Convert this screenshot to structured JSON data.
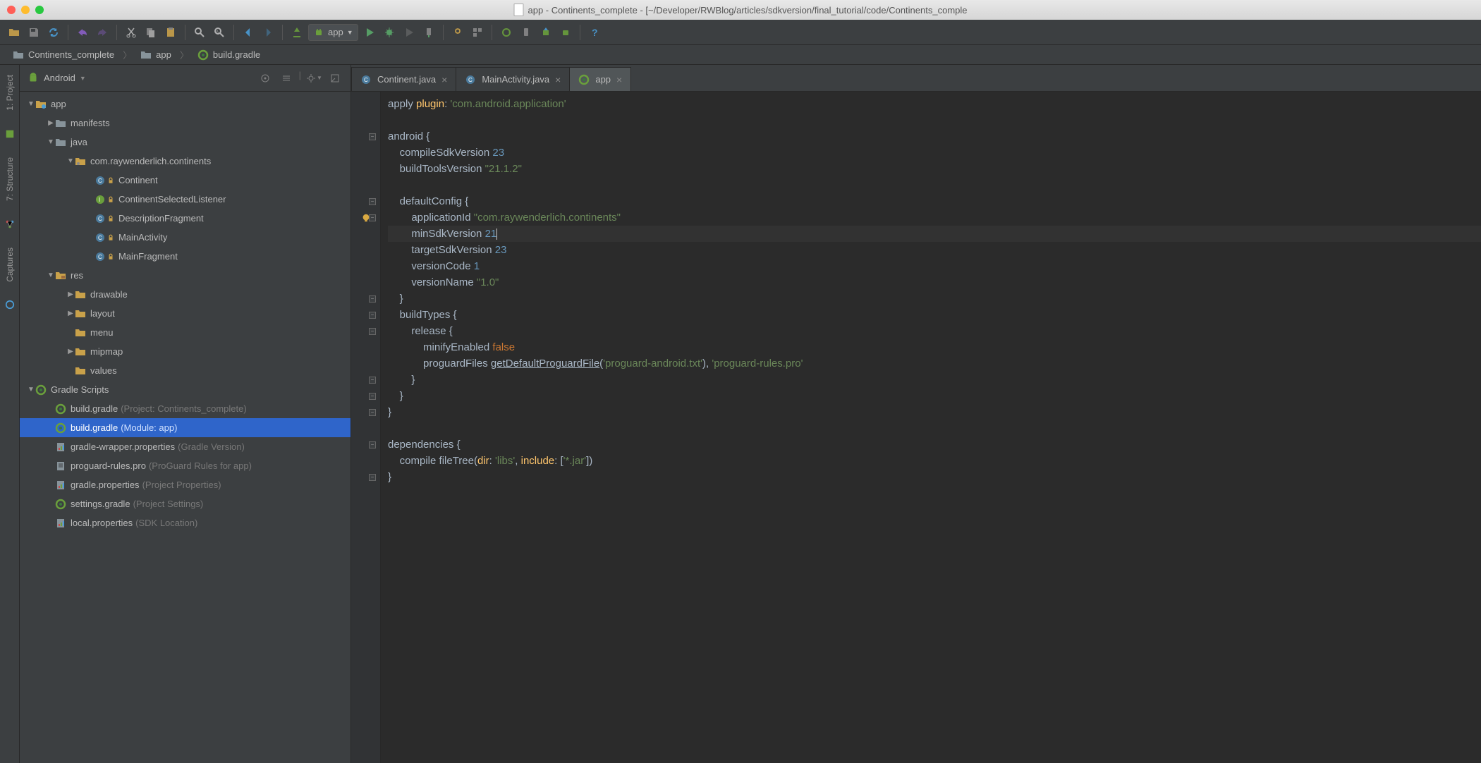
{
  "window": {
    "title": "app - Continents_complete - [~/Developer/RWBlog/articles/sdkversion/final_tutorial/code/Continents_comple"
  },
  "run_config": {
    "label": "app"
  },
  "breadcrumb": [
    {
      "icon": "folder",
      "label": "Continents_complete"
    },
    {
      "icon": "folder",
      "label": "app"
    },
    {
      "icon": "gradle",
      "label": "build.gradle"
    }
  ],
  "left_gutter": [
    {
      "icon": "project",
      "label": "1: Project"
    },
    {
      "icon": "structure",
      "label": "7: Structure"
    },
    {
      "icon": "captures",
      "label": "Captures"
    }
  ],
  "panel": {
    "view": "Android"
  },
  "tree": [
    {
      "d": 0,
      "exp": "open",
      "icon": "module",
      "label": "app"
    },
    {
      "d": 1,
      "exp": "closed",
      "icon": "folder",
      "label": "manifests"
    },
    {
      "d": 1,
      "exp": "open",
      "icon": "folder",
      "label": "java"
    },
    {
      "d": 2,
      "exp": "open",
      "icon": "package",
      "label": "com.raywenderlich.continents"
    },
    {
      "d": 3,
      "icon": "class",
      "label": "Continent"
    },
    {
      "d": 3,
      "icon": "interface",
      "label": "ContinentSelectedListener"
    },
    {
      "d": 3,
      "icon": "class",
      "label": "DescriptionFragment"
    },
    {
      "d": 3,
      "icon": "class",
      "label": "MainActivity"
    },
    {
      "d": 3,
      "icon": "class",
      "label": "MainFragment"
    },
    {
      "d": 1,
      "exp": "open",
      "icon": "res",
      "label": "res"
    },
    {
      "d": 2,
      "exp": "closed",
      "icon": "resfolder",
      "label": "drawable"
    },
    {
      "d": 2,
      "exp": "closed",
      "icon": "resfolder",
      "label": "layout"
    },
    {
      "d": 2,
      "icon": "resfolder",
      "label": "menu"
    },
    {
      "d": 2,
      "exp": "closed",
      "icon": "resfolder",
      "label": "mipmap"
    },
    {
      "d": 2,
      "icon": "resfolder",
      "label": "values"
    },
    {
      "d": 0,
      "exp": "open",
      "icon": "gradle",
      "label": "Gradle Scripts"
    },
    {
      "d": 1,
      "icon": "gradle",
      "label": "build.gradle",
      "hint": "(Project: Continents_complete)"
    },
    {
      "d": 1,
      "icon": "gradle",
      "label": "build.gradle",
      "hint": "(Module: app)",
      "selected": true
    },
    {
      "d": 1,
      "icon": "props",
      "label": "gradle-wrapper.properties",
      "hint": "(Gradle Version)"
    },
    {
      "d": 1,
      "icon": "file",
      "label": "proguard-rules.pro",
      "hint": "(ProGuard Rules for app)"
    },
    {
      "d": 1,
      "icon": "props",
      "label": "gradle.properties",
      "hint": "(Project Properties)"
    },
    {
      "d": 1,
      "icon": "gradle",
      "label": "settings.gradle",
      "hint": "(Project Settings)"
    },
    {
      "d": 1,
      "icon": "props",
      "label": "local.properties",
      "hint": "(SDK Location)"
    }
  ],
  "tabs": [
    {
      "icon": "class",
      "label": "Continent.java",
      "active": false
    },
    {
      "icon": "class",
      "label": "MainActivity.java",
      "active": false
    },
    {
      "icon": "gradle",
      "label": "app",
      "active": true
    }
  ],
  "code": {
    "lines": [
      [
        {
          "t": "apply ",
          "c": "id"
        },
        {
          "t": "plugin",
          "c": "fn"
        },
        {
          "t": ": ",
          "c": "id"
        },
        {
          "t": "'com.android.application'",
          "c": "str"
        }
      ],
      [],
      [
        {
          "t": "android {",
          "c": "id"
        }
      ],
      [
        {
          "t": "    compileSdkVersion ",
          "c": "id"
        },
        {
          "t": "23",
          "c": "num"
        }
      ],
      [
        {
          "t": "    buildToolsVersion ",
          "c": "id"
        },
        {
          "t": "\"21.1.2\"",
          "c": "str"
        }
      ],
      [],
      [
        {
          "t": "    defaultConfig {",
          "c": "id"
        }
      ],
      [
        {
          "t": "        applicationId ",
          "c": "id"
        },
        {
          "t": "\"com.raywenderlich.continents\"",
          "c": "str"
        }
      ],
      [
        {
          "t": "        minSdkVersion ",
          "c": "id"
        },
        {
          "t": "21",
          "c": "num"
        },
        {
          "t": "",
          "caret": true
        }
      ],
      [
        {
          "t": "        targetSdkVersion ",
          "c": "id"
        },
        {
          "t": "23",
          "c": "num"
        }
      ],
      [
        {
          "t": "        versionCode ",
          "c": "id"
        },
        {
          "t": "1",
          "c": "num"
        }
      ],
      [
        {
          "t": "        versionName ",
          "c": "id"
        },
        {
          "t": "\"1.0\"",
          "c": "str"
        }
      ],
      [
        {
          "t": "    }",
          "c": "id"
        }
      ],
      [
        {
          "t": "    buildTypes {",
          "c": "id"
        }
      ],
      [
        {
          "t": "        release {",
          "c": "id"
        }
      ],
      [
        {
          "t": "            minifyEnabled ",
          "c": "id"
        },
        {
          "t": "false",
          "c": "bool"
        }
      ],
      [
        {
          "t": "            proguardFiles ",
          "c": "id"
        },
        {
          "t": "getDefaultProguardFile",
          "c": "ul"
        },
        {
          "t": "(",
          "c": "id"
        },
        {
          "t": "'proguard-android.txt'",
          "c": "str"
        },
        {
          "t": "), ",
          "c": "id"
        },
        {
          "t": "'proguard-rules.pro'",
          "c": "str"
        }
      ],
      [
        {
          "t": "        }",
          "c": "id"
        }
      ],
      [
        {
          "t": "    }",
          "c": "id"
        }
      ],
      [
        {
          "t": "}",
          "c": "id"
        }
      ],
      [],
      [
        {
          "t": "dependencies {",
          "c": "id"
        }
      ],
      [
        {
          "t": "    compile ",
          "c": "id"
        },
        {
          "t": "fileTree",
          "c": "id"
        },
        {
          "t": "(",
          "c": "id"
        },
        {
          "t": "dir",
          "c": "fn"
        },
        {
          "t": ": ",
          "c": "id"
        },
        {
          "t": "'libs'",
          "c": "str"
        },
        {
          "t": ", ",
          "c": "id"
        },
        {
          "t": "include",
          "c": "fn"
        },
        {
          "t": ": [",
          "c": "id"
        },
        {
          "t": "'*.jar'",
          "c": "str"
        },
        {
          "t": "])",
          "c": "id"
        }
      ],
      [
        {
          "t": "}",
          "c": "id"
        }
      ]
    ],
    "highlight_line": 8,
    "bulb_line": 7,
    "fold_lines": [
      2,
      6,
      7,
      12,
      13,
      14,
      17,
      18,
      19,
      21,
      23
    ]
  }
}
